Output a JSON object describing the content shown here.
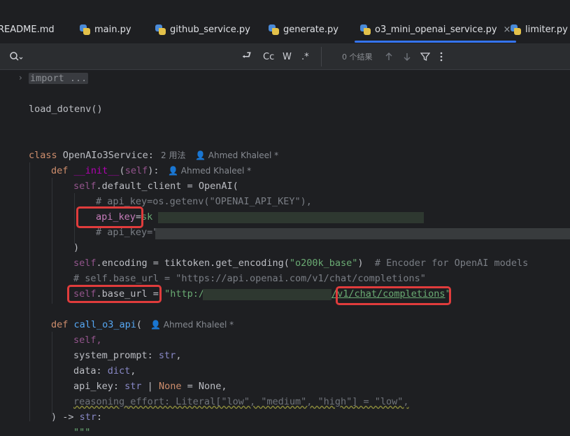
{
  "tabs": [
    {
      "label": "README.md",
      "active": false
    },
    {
      "label": "main.py",
      "active": false
    },
    {
      "label": "github_service.py",
      "active": false
    },
    {
      "label": "generate.py",
      "active": false
    },
    {
      "label": "o3_mini_openai_service.py",
      "active": true
    },
    {
      "label": "limiter.py",
      "active": false
    }
  ],
  "tab_close_glyph": "×",
  "search": {
    "replace_label": "⮐",
    "case_label": "Cc",
    "word_label": "W",
    "regex_label": ".*",
    "results": "0 个结果"
  },
  "hints": {
    "class_usages": "2 用法",
    "author": "Ahmed Khaleel *"
  },
  "code": {
    "import_fold": "import ...",
    "load_dotenv": "load_dotenv()",
    "class_kw": "class ",
    "class_name": "OpenAIo3Service:",
    "def_kw": "def ",
    "init_name": "__init__",
    "init_sig_open": "(",
    "self": "self",
    "init_sig_close": "):",
    "default_client_attr": ".default_client = OpenAI(",
    "c1": "# api_key=os.getenv(\"OPENAI_API_KEY\"),",
    "api_key_param": "api_key",
    "eq": "=",
    "sk_prefix": "sk",
    "c2_prefix": "# api_key=\"",
    "close_paren": ")",
    "encoding_attr": ".encoding = tiktoken.get_encoding(",
    "encoding_str": "\"o200k_base\"",
    "encoding_close": ")",
    "encoding_comment": "# Encoder for OpenAI models",
    "c3": "# self.base_url = \"https://api.openai.com/v1/chat/completions\"",
    "base_url_attr": ".base_url = ",
    "http_prefix": "\"http:/",
    "url_suffix": "/v1/chat/completions",
    "url_close": "\"",
    "call_name": "call_o3_api",
    "call_open": "(",
    "p_self": "self,",
    "p_system_prompt": "system_prompt: ",
    "t_str": "str",
    "comma": ",",
    "p_data": "data: ",
    "t_dict": "dict",
    "p_api_key": "api_key: ",
    "t_pipe": " | ",
    "t_none": "None",
    "t_none_default": " = None,",
    "p_reasoning": "reasoning_effort: Literal[\"low\", \"medium\", \"high\"] = \"low\",",
    "ret": ") -> ",
    "ret_colon": ":",
    "docstring": "\"\"\""
  },
  "colors": {
    "accent": "#3574f0",
    "highlight_box": "#e03c3c"
  }
}
